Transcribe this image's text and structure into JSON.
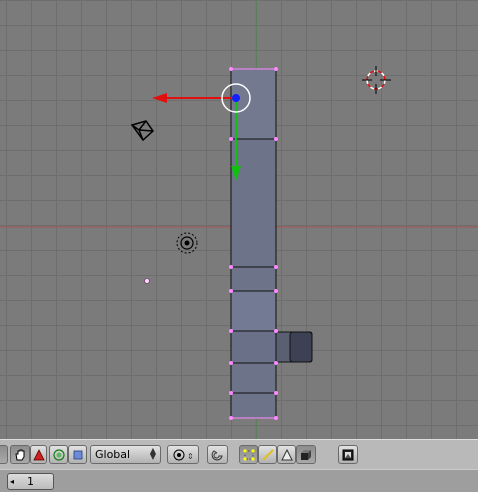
{
  "viewport": {
    "objects": [
      "camera-icon",
      "lamp-icon",
      "3d-cursor-icon",
      "mesh-object",
      "manipulator-widget"
    ]
  },
  "header": {
    "transform_orientation": "Global",
    "icons": [
      "hand-grab-icon",
      "rotate-triangle-icon",
      "scale-circle-icon",
      "square-icon",
      "pivot-circle-icon",
      "magnet-snap-icon",
      "vertex-select-icon",
      "edge-select-icon",
      "face-select-icon",
      "cube-occlude-icon",
      "render-icon"
    ]
  },
  "status": {
    "current_frame": "1"
  },
  "colors": {
    "viewport_bg": "#7b7b7b",
    "grid_line": "#6e6e6e",
    "x_axis": "#c0302e",
    "y_axis": "#2e9a2e",
    "mesh_face": "#6d7388",
    "mesh_edge": "#000000",
    "mesh_selected_vertex": "#ff88ff",
    "header_bg": "#b9b9b9"
  }
}
